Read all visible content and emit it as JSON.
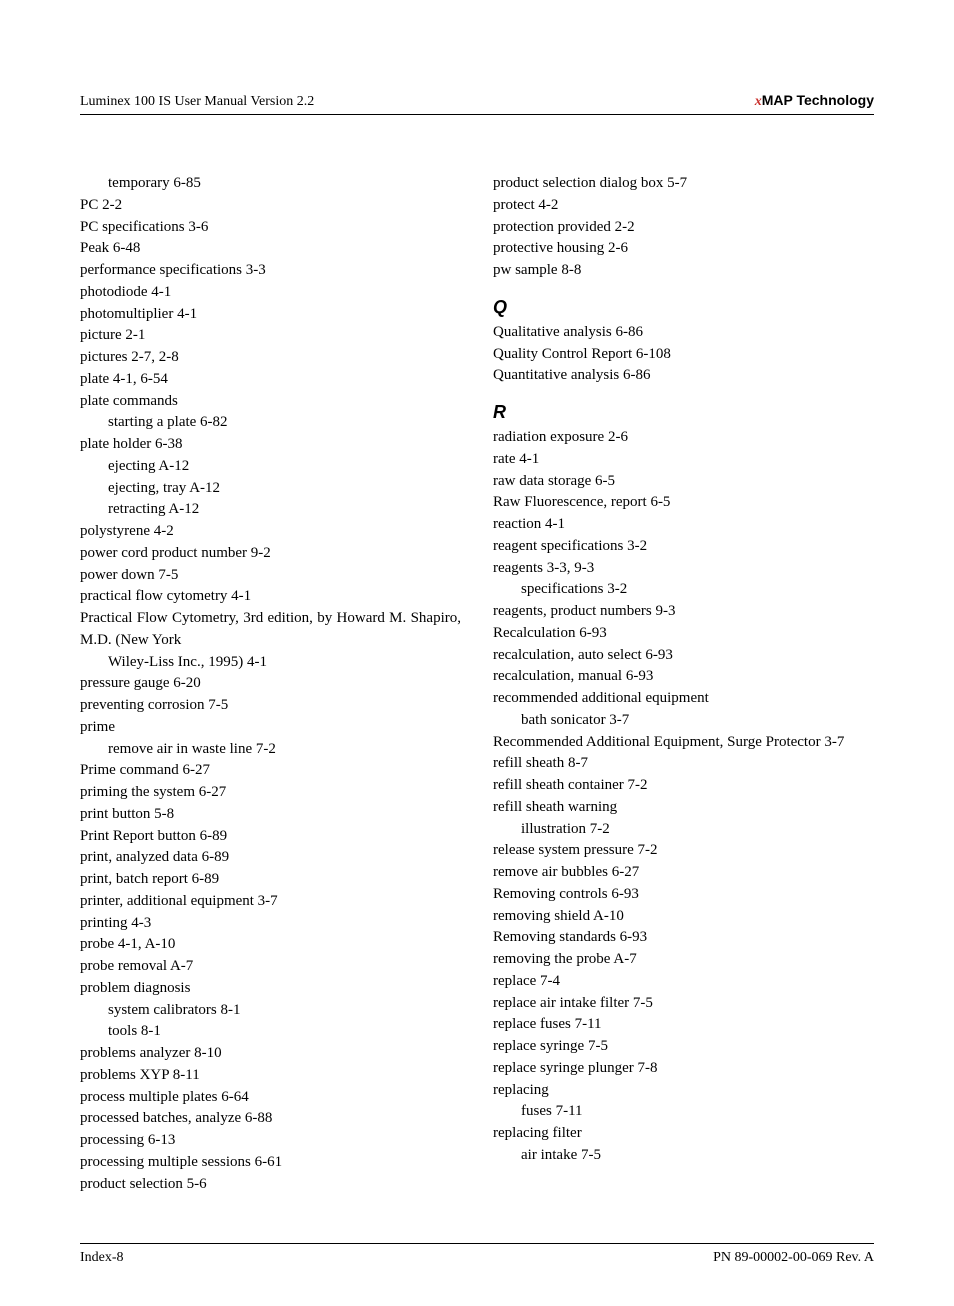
{
  "header": {
    "left": "Luminex 100 IS User Manual Version 2.2",
    "right_prefix": "x",
    "right_rest": "MAP Technology"
  },
  "col1": [
    {
      "t": "temporary 6-85",
      "sub": true
    },
    {
      "t": "PC 2-2"
    },
    {
      "t": "PC specifications 3-6"
    },
    {
      "t": "Peak 6-48"
    },
    {
      "t": "performance specifications 3-3"
    },
    {
      "t": "photodiode 4-1"
    },
    {
      "t": "photomultiplier 4-1"
    },
    {
      "t": "picture 2-1"
    },
    {
      "t": "pictures 2-7, 2-8"
    },
    {
      "t": "plate 4-1, 6-54"
    },
    {
      "t": "plate commands"
    },
    {
      "t": "starting a plate 6-82",
      "sub": true
    },
    {
      "t": "plate holder 6-38"
    },
    {
      "t": "ejecting A-12",
      "sub": true
    },
    {
      "t": "ejecting, tray A-12",
      "sub": true
    },
    {
      "t": "retracting A-12",
      "sub": true
    },
    {
      "t": "polystyrene 4-2"
    },
    {
      "t": "power cord product number 9-2"
    },
    {
      "t": "power down 7-5"
    },
    {
      "t": "practical flow cytometry 4-1"
    },
    {
      "t": "Practical Flow Cytometry, 3rd edition, by Howard M. Shapiro, M.D. (New York",
      "justify": true
    },
    {
      "t": "Wiley-Liss Inc., 1995) 4-1",
      "sub": true
    },
    {
      "t": "pressure gauge 6-20"
    },
    {
      "t": "preventing corrosion 7-5"
    },
    {
      "t": "prime"
    },
    {
      "t": "remove air in waste line 7-2",
      "sub": true
    },
    {
      "t": "Prime command 6-27"
    },
    {
      "t": "priming the system 6-27"
    },
    {
      "t": "print button 5-8"
    },
    {
      "t": "Print Report button 6-89"
    },
    {
      "t": "print, analyzed data 6-89"
    },
    {
      "t": "print, batch report 6-89"
    },
    {
      "t": "printer, additional equipment 3-7"
    },
    {
      "t": "printing 4-3"
    },
    {
      "t": "probe 4-1, A-10"
    },
    {
      "t": "probe removal A-7"
    },
    {
      "t": "problem diagnosis"
    },
    {
      "t": "system calibrators 8-1",
      "sub": true
    },
    {
      "t": "tools 8-1",
      "sub": true
    },
    {
      "t": "problems analyzer 8-10"
    },
    {
      "t": "problems XYP 8-11"
    },
    {
      "t": "process multiple plates 6-64"
    },
    {
      "t": "processed batches, analyze 6-88"
    },
    {
      "t": "processing 6-13"
    },
    {
      "t": "processing multiple sessions 6-61"
    },
    {
      "t": "product selection 5-6"
    }
  ],
  "col2": [
    {
      "t": "product selection dialog box 5-7"
    },
    {
      "t": "protect 4-2"
    },
    {
      "t": "protection provided 2-2"
    },
    {
      "t": "protective housing 2-6"
    },
    {
      "t": "pw sample 8-8"
    },
    {
      "letter": "Q"
    },
    {
      "t": "Qualitative analysis 6-86"
    },
    {
      "t": "Quality Control Report 6-108"
    },
    {
      "t": "Quantitative analysis 6-86"
    },
    {
      "letter": "R"
    },
    {
      "t": "radiation exposure 2-6"
    },
    {
      "t": "rate 4-1"
    },
    {
      "t": "raw data storage 6-5"
    },
    {
      "t": "Raw Fluorescence, report 6-5"
    },
    {
      "t": "reaction 4-1"
    },
    {
      "t": "reagent specifications 3-2"
    },
    {
      "t": "reagents 3-3, 9-3"
    },
    {
      "t": "specifications 3-2",
      "sub": true
    },
    {
      "t": "reagents, product numbers 9-3"
    },
    {
      "t": "Recalculation 6-93"
    },
    {
      "t": "recalculation, auto select 6-93"
    },
    {
      "t": "recalculation, manual 6-93"
    },
    {
      "t": "recommended additional equipment"
    },
    {
      "t": "bath sonicator 3-7",
      "sub": true
    },
    {
      "t": "Recommended Additional Equipment, Surge Protector 3-7",
      "justify": true
    },
    {
      "t": "refill sheath 8-7"
    },
    {
      "t": "refill sheath container 7-2"
    },
    {
      "t": "refill sheath warning"
    },
    {
      "t": "illustration 7-2",
      "sub": true
    },
    {
      "t": "release system pressure 7-2"
    },
    {
      "t": "remove air bubbles 6-27"
    },
    {
      "t": "Removing controls 6-93"
    },
    {
      "t": "removing shield A-10"
    },
    {
      "t": "Removing standards 6-93"
    },
    {
      "t": "removing the probe A-7"
    },
    {
      "t": "replace 7-4"
    },
    {
      "t": "replace air intake filter 7-5"
    },
    {
      "t": "replace fuses 7-11"
    },
    {
      "t": "replace syringe 7-5"
    },
    {
      "t": "replace syringe plunger 7-8"
    },
    {
      "t": "replacing"
    },
    {
      "t": "fuses 7-11",
      "sub": true
    },
    {
      "t": "replacing filter"
    },
    {
      "t": "air intake 7-5",
      "sub": true
    }
  ],
  "footer": {
    "left": "Index-8",
    "right": "PN 89-00002-00-069 Rev. A"
  }
}
